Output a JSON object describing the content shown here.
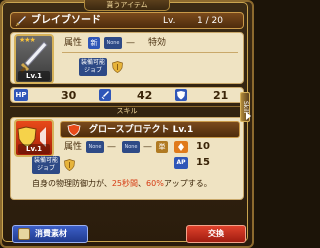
{
  "header": {
    "title": "貰うアイテム"
  },
  "item": {
    "name": "ブレイブソード",
    "lv_label": "Lv.",
    "level": "1 / 20",
    "stars": "★★★",
    "thumb_level": "Lv.1",
    "attribute_label": "属性",
    "attribute_new": "新",
    "attribute_none_1": "None",
    "attribute_dash": "—",
    "special_label": "特効",
    "job_label": "装備可能 ジョブ",
    "icon": "sword-icon"
  },
  "stats": {
    "hp_label": "HP",
    "hp": "30",
    "atk": "42",
    "def": "21"
  },
  "skill": {
    "section_label": "スキル",
    "thumb_level": "Lv.1",
    "name": "グロースプロテクト Lv.1",
    "attribute_label": "属性",
    "attribute_none_1": "None",
    "attribute_dash": "—",
    "attribute_none_2": "None",
    "attribute_dash2": "—",
    "target": "単",
    "cost_sp": "10",
    "cost_ap_label": "AP",
    "cost_ap": "15",
    "job_label": "装備可能 ジョブ",
    "desc_prefix": "自身の物理防御力が、",
    "desc_turns": "25秒間",
    "desc_mid": "、",
    "desc_percent": "60%",
    "desc_suffix": "アップする。"
  },
  "side_tab": {
    "label": "Skill"
  },
  "buttons": {
    "material": "消費素材",
    "exchange": "交換"
  },
  "colors": {
    "frame": "#8c6a2e",
    "panel": "#efe3c2",
    "exchange": "#c8321e",
    "material": "#2f4fb0",
    "highlight": "#d63a12"
  }
}
